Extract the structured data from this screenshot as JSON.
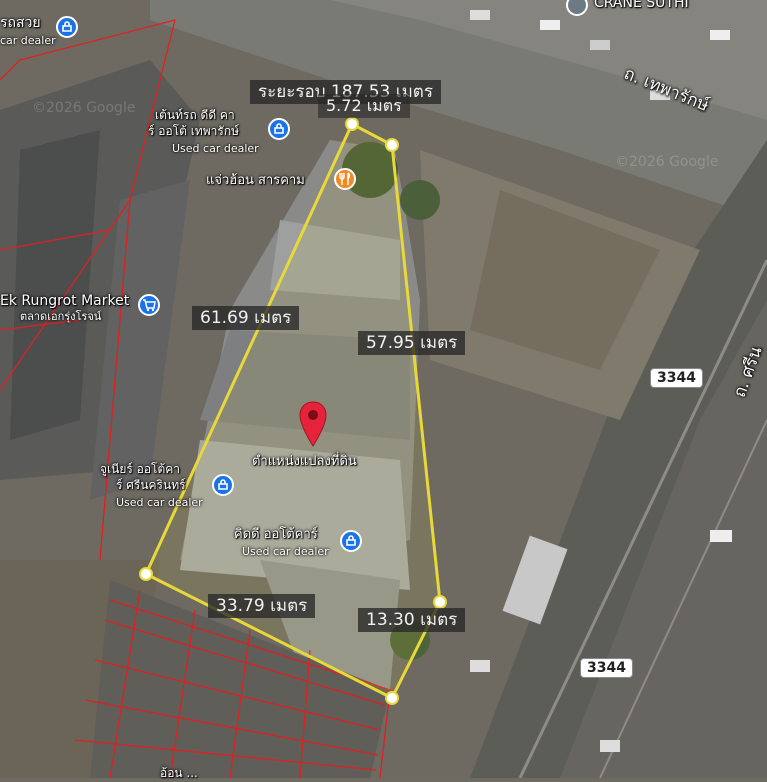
{
  "map": {
    "total_distance_label": "ระยะรอบ 187.53 เมตร",
    "top_edge_label": "5.72 เมตร",
    "west_edge_label": "61.69 เมตร",
    "east_edge_label": "57.95 เมตร",
    "south_edge_label": "33.79 เมตร",
    "southeast_edge_label": "13.30 เมตร",
    "pin_label": "ตำแหน่งแปลงที่ดิน",
    "watermark_1": "©2026 Google",
    "watermark_2": "©2026 Google"
  },
  "pois": {
    "car_dealer_top_left": {
      "name": "รถสวย",
      "sub": "car dealer"
    },
    "crane": {
      "name": "CRANE SUTHI"
    },
    "cd_deenthod": {
      "name_line1": "เต้นท์รถ ดีดี คา",
      "name_line2": "ร์ ออโต้ เทพารักษ์",
      "sub": "Used car dealer"
    },
    "restaurant": {
      "name": "แจ่วฮ้อน สารคาม"
    },
    "market": {
      "name": "Ek Rungrot Market",
      "sub": "ตลาดเอกรุ่งโรจน์"
    },
    "cd_junior": {
      "name_line1": "จูเนียร์ ออโต้คา",
      "name_line2": "ร์ ศรีนครินทร์",
      "sub": "Used car dealer"
    },
    "cd_kiddee": {
      "name": "คิดดี ออโต้คาร์",
      "sub": "Used car dealer"
    },
    "bottom_partial": {
      "name": "อ้อน ..."
    }
  },
  "roads": {
    "theparak": "ถ. เทพารักษ์",
    "srinakarin": "ถ. ศรีน",
    "route_number_1": "3344",
    "route_number_2": "3344"
  },
  "icons": {
    "car_dealer": "car-dealer-icon",
    "restaurant": "fork-knife-icon",
    "market": "shopping-cart-icon",
    "pin": "map-pin-icon",
    "crane": "wrench-icon"
  },
  "colors": {
    "polygon_line": "#e8d83a",
    "parcel_border": "#e02020",
    "poi_blue": "#1a73e8",
    "poi_orange": "#f08a24",
    "pin_red": "#e5243b"
  }
}
